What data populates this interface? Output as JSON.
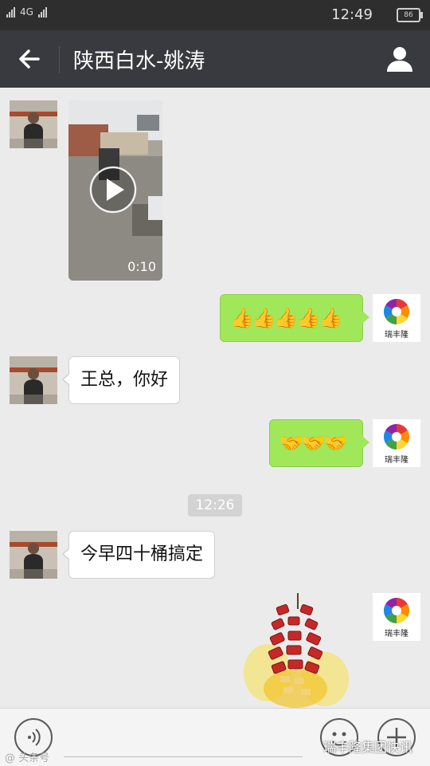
{
  "status_bar": {
    "network": "4G",
    "time": "12:49",
    "battery": "86"
  },
  "header": {
    "title": "陕西白水-姚涛"
  },
  "messages": {
    "video_duration": "0:10",
    "r1_emoji": "👍👍👍👍👍",
    "l2_text": "王总，你好",
    "r2_emoji": "🤝🤝🤝",
    "timestamp": "12:26",
    "l3_text": "今早四十桶搞定"
  },
  "brand": {
    "name": "瑞丰隆"
  },
  "watermark": {
    "left": "@ 头条号",
    "right": "瑞丰隆集团快讯"
  },
  "colors": {
    "titlebar": "#393a3f",
    "bubble_sent": "#a0e75a",
    "bubble_received": "#ffffff",
    "background": "#ebebeb"
  }
}
